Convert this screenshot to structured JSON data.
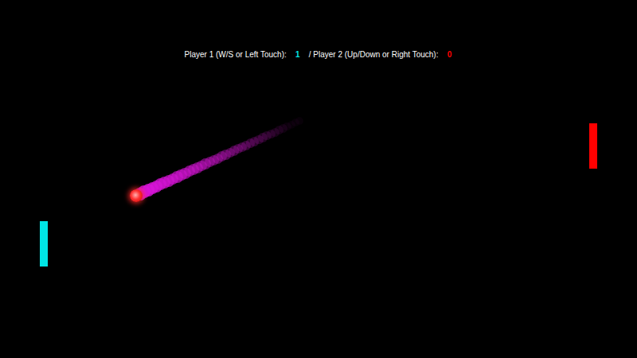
{
  "players": [
    {
      "label": "Player 1 (W/S or Left Touch):",
      "score": "1",
      "color": "#00e5e5"
    },
    {
      "label": "/ Player 2 (Up/Down or Right Touch):",
      "score": "0",
      "color": "#ff0000"
    }
  ]
}
